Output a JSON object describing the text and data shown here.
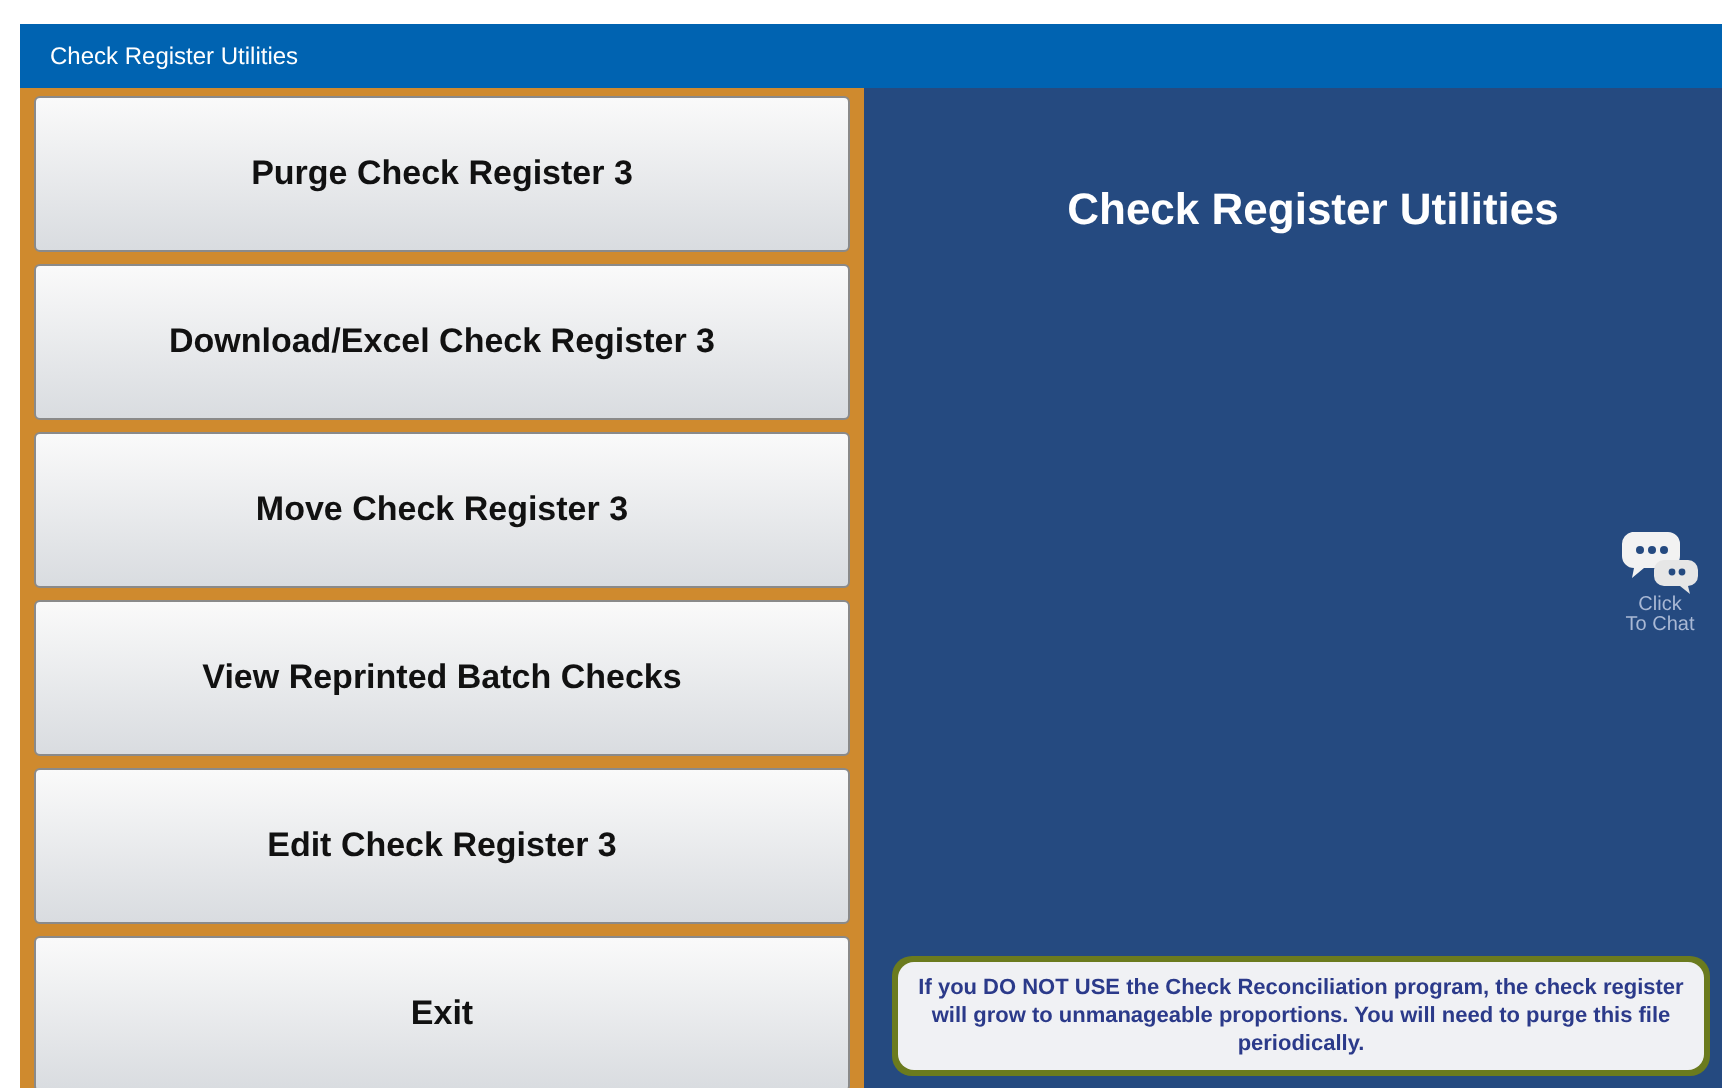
{
  "window": {
    "title": "Check Register Utilities"
  },
  "buttons": [
    "Purge Check Register 3",
    "Download/Excel Check Register 3",
    "Move Check Register 3",
    "View Reprinted Batch Checks",
    "Edit Check Register 3",
    "Exit"
  ],
  "panel": {
    "heading": "Check Register Utilities",
    "chat_label": "Click\nTo Chat",
    "notice": "If you DO NOT USE the Check Reconciliation program, the check register will grow to unmanageable proportions.  You will need to purge this file periodically."
  }
}
